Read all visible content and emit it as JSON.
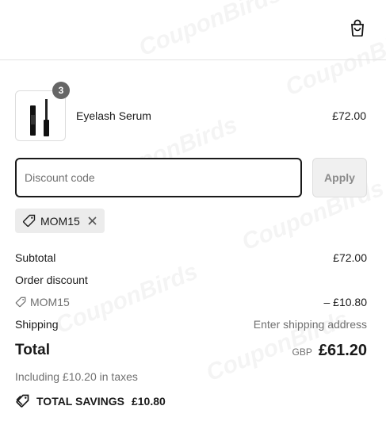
{
  "watermark": "CouponBirds",
  "header": {
    "cart_icon": "shopping-bag-icon"
  },
  "product": {
    "quantity": "3",
    "name": "Eyelash Serum",
    "price": "£72.00",
    "image_icon": "mascara-serum-icon"
  },
  "discount": {
    "placeholder": "Discount code",
    "apply_label": "Apply",
    "applied_code": "MOM15"
  },
  "summary": {
    "subtotal_label": "Subtotal",
    "subtotal_value": "£72.00",
    "order_discount_label": "Order discount",
    "discount_code": "MOM15",
    "discount_value": "– £10.80",
    "shipping_label": "Shipping",
    "shipping_value": "Enter shipping address",
    "total_label": "Total",
    "currency": "GBP",
    "total_value": "£61.20",
    "taxes_note": "Including £10.20 in taxes",
    "savings_label": "TOTAL SAVINGS",
    "savings_value": "£10.80"
  }
}
